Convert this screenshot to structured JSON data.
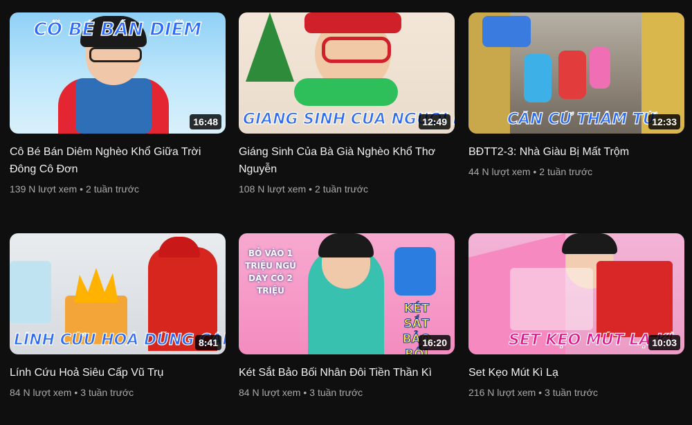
{
  "videos": [
    {
      "title": "Cô Bé Bán Diêm Nghèo Khổ Giữa Trời Đông Cô Đơn",
      "views": "139 N lượt xem",
      "age": "2 tuần trước",
      "duration": "16:48",
      "caption_top": "CÔ BÉ       BÁN DIÊM",
      "caption_bottom": ""
    },
    {
      "title": "Giáng Sinh Của Bà Già Nghèo Khổ Thơ Nguyễn",
      "views": "108 N lượt xem",
      "age": "2 tuần trước",
      "duration": "12:49",
      "caption_top": "",
      "caption_bottom": "GIÁNG SINH CỦA NGƯỜI NG"
    },
    {
      "title": "BĐTT2-3: Nhà Giàu Bị Mất Trộm",
      "views": "44 N lượt xem",
      "age": "2 tuần trước",
      "duration": "12:33",
      "caption_top": "",
      "caption_bottom": "CĂN CỨ THÁM TỬ"
    },
    {
      "title": "Lính Cứu Hoả Siêu Cấp Vũ Trụ",
      "views": "84 N lượt xem",
      "age": "3 tuần trước",
      "duration": "8:41",
      "caption_top": "",
      "caption_bottom": "LÍNH CỨU HOẢ DŨNG CẢM"
    },
    {
      "title": "Két Sắt Bảo Bối Nhân Đôi Tiền Thần Kì",
      "views": "84 N lượt xem",
      "age": "3 tuần trước",
      "duration": "16:20",
      "caption_top": "",
      "caption_bottom": "",
      "badge_left": "BỎ VÀO 1 TRIỆU NGỦ DẬY CÓ 2 TRIỆU",
      "badge_right": "KÉT SẮT BẢO BỐI"
    },
    {
      "title": "Set Kẹo Mút Kì Lạ",
      "views": "216 N lượt xem",
      "age": "3 tuần trước",
      "duration": "10:03",
      "caption_top": "",
      "caption_bottom": "SET KẸO MÚT LẠ KÌ"
    }
  ],
  "meta_separator": "•"
}
